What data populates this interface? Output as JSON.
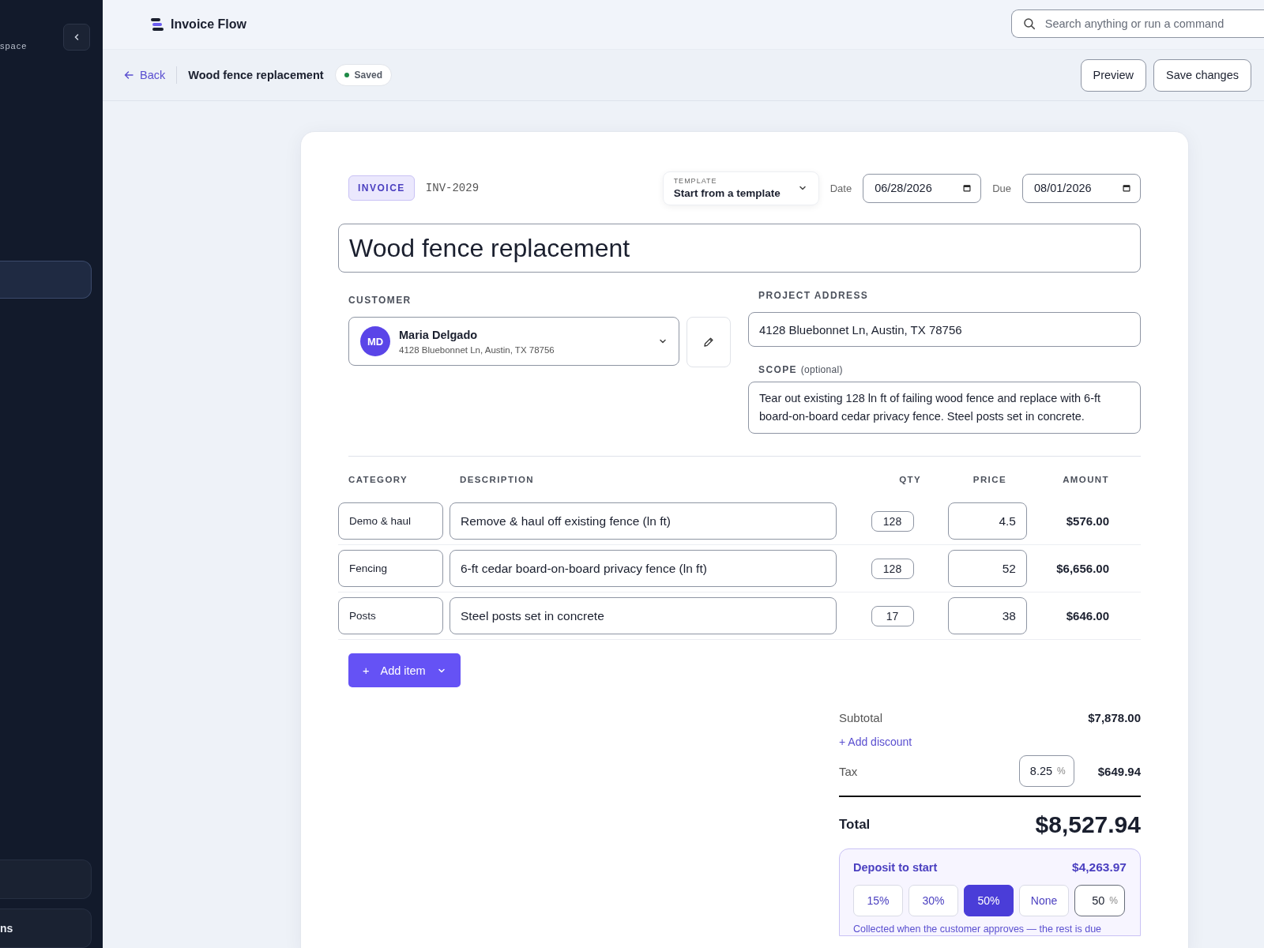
{
  "sidebar": {
    "workspace_label": "space",
    "items": [
      {
        "selected": true
      },
      {
        "selected": false
      },
      {
        "label": "ns",
        "selected": false
      }
    ]
  },
  "app": {
    "name": "Invoice Flow"
  },
  "search": {
    "placeholder": "Search anything or run a command"
  },
  "header": {
    "back": "Back",
    "title": "Wood fence replacement",
    "status": "Saved",
    "buttons": [
      "Preview",
      "Save changes"
    ]
  },
  "invoice": {
    "badge": "INVOICE",
    "number": "INV-2029",
    "template": {
      "label": "TEMPLATE",
      "value": "Start from a template"
    },
    "date": {
      "label": "Date",
      "value": "06/28/2026"
    },
    "due": {
      "label": "Due",
      "value": "08/01/2026"
    },
    "title": "Wood fence replacement",
    "customer": {
      "label": "CUSTOMER",
      "initials": "MD",
      "name": "Maria Delgado",
      "address": "4128 Bluebonnet Ln, Austin, TX 78756"
    },
    "project_address": {
      "label": "PROJECT ADDRESS",
      "value": "4128 Bluebonnet Ln, Austin, TX 78756"
    },
    "scope": {
      "label": "SCOPE",
      "hint": "(optional)",
      "value": "Tear out existing 128 ln ft of failing wood fence and replace with 6-ft board-on-board cedar privacy fence. Steel posts set in concrete."
    },
    "columns": [
      "CATEGORY",
      "DESCRIPTION",
      "QTY",
      "PRICE",
      "AMOUNT"
    ],
    "rows": [
      {
        "category": "Demo & haul",
        "description": "Remove & haul off existing fence (ln ft)",
        "qty": "128",
        "price": "4.5",
        "amount": "$576.00"
      },
      {
        "category": "Fencing",
        "description": "6-ft cedar board-on-board privacy fence (ln ft)",
        "qty": "128",
        "price": "52",
        "amount": "$6,656.00"
      },
      {
        "category": "Posts",
        "description": "Steel posts set in concrete",
        "qty": "17",
        "price": "38",
        "amount": "$646.00"
      }
    ],
    "add_item": {
      "icon": "+",
      "label": "Add item"
    },
    "totals": {
      "subtotal_label": "Subtotal",
      "subtotal": "$7,878.00",
      "add_discount": "+ Add discount",
      "tax_label": "Tax",
      "tax_rate": "8.25",
      "tax_unit": "%",
      "tax": "$649.94",
      "total_label": "Total",
      "total": "$8,527.94"
    },
    "deposit": {
      "title": "Deposit to start",
      "amount": "$4,263.97",
      "options": [
        {
          "label": "15%",
          "selected": false
        },
        {
          "label": "30%",
          "selected": false
        },
        {
          "label": "50%",
          "selected": true
        },
        {
          "label": "None",
          "selected": false
        }
      ],
      "custom": {
        "value": "50",
        "unit": "%"
      },
      "note": "Collected when the customer approves — the rest is due"
    }
  }
}
